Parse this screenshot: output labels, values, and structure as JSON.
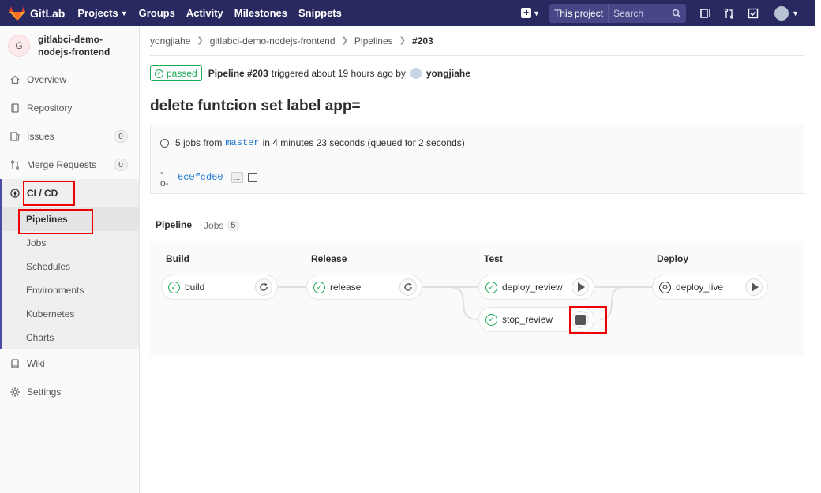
{
  "nav": {
    "brand": "GitLab",
    "links": [
      {
        "label": "Projects",
        "caret": true
      },
      {
        "label": "Groups",
        "caret": false
      },
      {
        "label": "Activity",
        "caret": false
      },
      {
        "label": "Milestones",
        "caret": false
      },
      {
        "label": "Snippets",
        "caret": false
      }
    ],
    "scope_label": "This project",
    "search_placeholder": "Search"
  },
  "sidebar": {
    "project_initial": "G",
    "project_name": "gitlabci-demo-nodejs-frontend",
    "items": [
      {
        "label": "Overview",
        "icon": "home-icon"
      },
      {
        "label": "Repository",
        "icon": "book-icon"
      },
      {
        "label": "Issues",
        "icon": "issues-icon",
        "count": "0"
      },
      {
        "label": "Merge Requests",
        "icon": "merge-request-icon",
        "count": "0"
      }
    ],
    "cicd_label": "CI / CD",
    "sub_items": [
      "Pipelines",
      "Jobs",
      "Schedules",
      "Environments",
      "Kubernetes",
      "Charts"
    ],
    "bottom_items": [
      {
        "label": "Wiki",
        "icon": "wiki-icon"
      },
      {
        "label": "Settings",
        "icon": "gear-icon"
      }
    ]
  },
  "breadcrumb": [
    "yongjiahe",
    "gitlabci-demo-nodejs-frontend",
    "Pipelines",
    "#203"
  ],
  "pipeline": {
    "status": "passed",
    "id_text": "Pipeline #203",
    "triggered_text": "triggered about 19 hours ago by",
    "user": "yongjiahe",
    "title": "delete funtcion set label app=",
    "jobs_prefix": "5 jobs from",
    "branch": "master",
    "jobs_suffix": "in 4 minutes 23 seconds (queued for 2 seconds)",
    "commit": "6c0fcd60",
    "ellipsis": "..."
  },
  "tabs": [
    {
      "label": "Pipeline"
    },
    {
      "label": "Jobs",
      "count": "5"
    }
  ],
  "stages": [
    {
      "name": "Build",
      "jobs": [
        {
          "name": "build",
          "action": "retry"
        }
      ]
    },
    {
      "name": "Release",
      "jobs": [
        {
          "name": "release",
          "action": "retry"
        }
      ]
    },
    {
      "name": "Test",
      "jobs": [
        {
          "name": "deploy_review",
          "action": "play"
        },
        {
          "name": "stop_review",
          "action": "stop"
        }
      ]
    },
    {
      "name": "Deploy",
      "jobs": [
        {
          "name": "deploy_live",
          "action": "play",
          "status": "manual"
        }
      ]
    }
  ],
  "colors": {
    "nav": "#292961",
    "success": "#1aaa55",
    "highlight": "#ee0000"
  }
}
